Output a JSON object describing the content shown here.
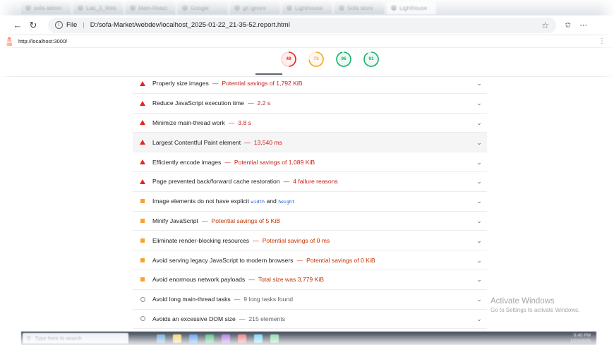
{
  "browser": {
    "tabs": [
      {
        "label": "sofa-admin"
      },
      {
        "label": "Lab_3_Web"
      },
      {
        "label": "Main-React"
      },
      {
        "label": "Google"
      },
      {
        "label": "git ignore"
      },
      {
        "label": "Lighthouse"
      },
      {
        "label": "Sofa store"
      },
      {
        "label": "Lighthouse"
      }
    ],
    "back_icon": "arrow-left-icon",
    "reload_icon": "reload-icon",
    "address": {
      "scheme_label": "File",
      "url": "D:/sofa-Market/webdev/localhost_2025-01-22_21-35-52.report.html"
    },
    "right_icons": [
      "star-icon",
      "favorites-icon",
      "more-icon"
    ]
  },
  "report": {
    "url": "http://localhost:3000/",
    "gauges": [
      {
        "score": "49",
        "color": "#e8261e",
        "fraction": 0.49
      },
      {
        "score": "73",
        "color": "#f5a623",
        "fraction": 0.73
      },
      {
        "score": "96",
        "color": "#17b169",
        "fraction": 0.96
      },
      {
        "score": "91",
        "color": "#17b169",
        "fraction": 0.91
      }
    ],
    "audits": [
      {
        "status": "fail",
        "title": "Properly size images",
        "detail": "Potential savings of 1,792 KiB"
      },
      {
        "status": "fail",
        "title": "Reduce JavaScript execution time",
        "detail": "2.2 s"
      },
      {
        "status": "fail",
        "title": "Minimize main-thread work",
        "detail": "3.8 s"
      },
      {
        "status": "fail",
        "title": "Largest Contentful Paint element",
        "detail": "13,540 ms"
      },
      {
        "status": "fail",
        "title": "Efficiently encode images",
        "detail": "Potential savings of 1,089 KiB"
      },
      {
        "status": "fail",
        "title": "Page prevented back/forward cache restoration",
        "detail": "4 failure reasons"
      },
      {
        "status": "warn",
        "title_prefix": "Image elements do not have explicit ",
        "code1": "width",
        "mid": " and ",
        "code2": "height"
      },
      {
        "status": "warn",
        "title": "Minify JavaScript",
        "detail": "Potential savings of 5 KiB"
      },
      {
        "status": "warn",
        "title": "Eliminate render-blocking resources",
        "detail": "Potential savings of 0 ms"
      },
      {
        "status": "warn",
        "title": "Avoid serving legacy JavaScript to modern browsers",
        "detail": "Potential savings of 0 KiB"
      },
      {
        "status": "warn",
        "title": "Avoid enormous network payloads",
        "detail": "Total size was 3,779 KiB"
      },
      {
        "status": "info",
        "title": "Avoid long main-thread tasks",
        "detail": "9 long tasks found"
      },
      {
        "status": "info",
        "title": "Avoids an excessive DOM size",
        "detail": "215 elements"
      }
    ]
  },
  "watermark": {
    "line1": "Activate Windows",
    "line2": "Go to Settings to activate Windows."
  },
  "taskbar": {
    "search_placeholder": "Type here to search",
    "time": "9:40 PM",
    "date": "1/22/2025"
  }
}
